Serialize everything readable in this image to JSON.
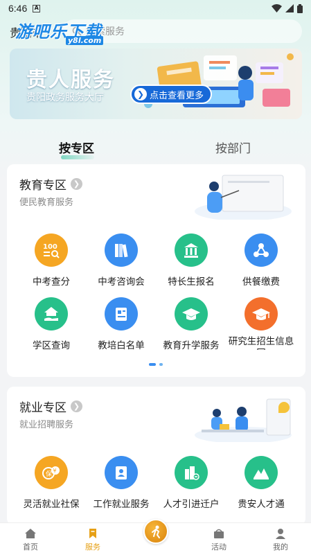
{
  "status": {
    "time": "6:46",
    "notif_letter": "A"
  },
  "header": {
    "city": "贵阳市",
    "search_placeholder": "搜索服务",
    "watermark": "游吧乐下载",
    "watermark_url": "y8l.com"
  },
  "banner": {
    "title": "贵人服务",
    "subtitle": "贵阳政务服务大厅",
    "button": "点击查看更多"
  },
  "tabs": [
    {
      "label": "按专区",
      "active": true
    },
    {
      "label": "按部门",
      "active": false
    }
  ],
  "sections": [
    {
      "title": "教育专区",
      "subtitle": "便民教育服务",
      "items": [
        {
          "label": "中考查分",
          "icon": "score-search-icon",
          "color": "#f5a623"
        },
        {
          "label": "中考咨询会",
          "icon": "books-icon",
          "color": "#3a8ef0"
        },
        {
          "label": "特长生报名",
          "icon": "building-icon",
          "color": "#27c08a"
        },
        {
          "label": "供餐缴费",
          "icon": "molecule-icon",
          "color": "#3a8ef0"
        },
        {
          "label": "学区查询",
          "icon": "house-hand-icon",
          "color": "#27c08a"
        },
        {
          "label": "教培白名单",
          "icon": "id-card-icon",
          "color": "#3a8ef0"
        },
        {
          "label": "教育升学服务",
          "icon": "graduation-cap-icon",
          "color": "#27c08a"
        },
        {
          "label": "研究生招生信息网",
          "icon": "graduation-cap-icon",
          "color": "#f36f2c"
        }
      ]
    },
    {
      "title": "就业专区",
      "subtitle": "就业招聘服务",
      "items": [
        {
          "label": "灵活就业社保",
          "icon": "insurance-icon",
          "color": "#f5a623"
        },
        {
          "label": "工作就业服务",
          "icon": "profile-card-icon",
          "color": "#3a8ef0"
        },
        {
          "label": "人才引进迁户",
          "icon": "city-transfer-icon",
          "color": "#27c08a"
        },
        {
          "label": "贵安人才通",
          "icon": "mountain-icon",
          "color": "#27c08a"
        }
      ]
    }
  ],
  "nav": {
    "items": [
      {
        "label": "首页",
        "icon": "home-icon",
        "active": false
      },
      {
        "label": "服务",
        "icon": "bookmark-icon",
        "active": true
      },
      {
        "label": "",
        "icon": "runner-logo-icon",
        "active": false
      },
      {
        "label": "活动",
        "icon": "gift-bag-icon",
        "active": false
      },
      {
        "label": "我的",
        "icon": "user-icon",
        "active": false
      }
    ]
  },
  "colors": {
    "accent": "#e6a016",
    "blue": "#3a8ef0",
    "green": "#27c08a",
    "orange": "#f5a623"
  }
}
